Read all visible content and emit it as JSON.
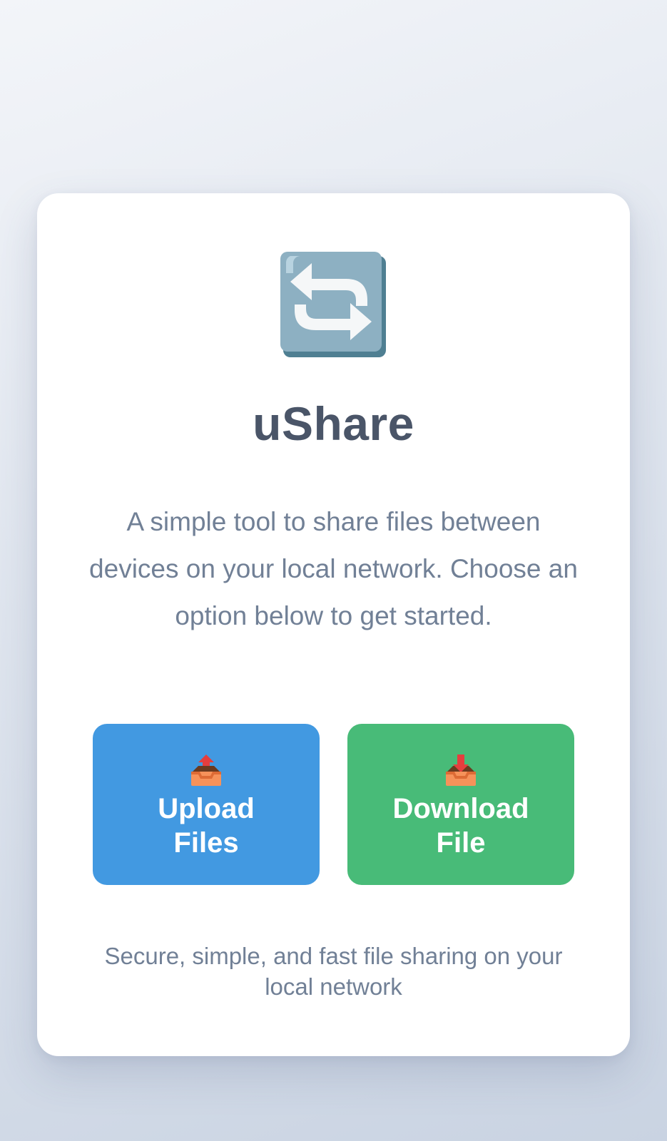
{
  "app": {
    "title": "uShare",
    "logo_icon": "repeat-arrows-icon",
    "description": "A simple tool to share files between devices on your local network. Choose an option below to get started."
  },
  "actions": {
    "upload": {
      "label": "Upload Files",
      "icon": "outbox-tray-icon",
      "color": "#4299e1"
    },
    "download": {
      "label": "Download File",
      "icon": "inbox-tray-icon",
      "color": "#48bb78"
    }
  },
  "footer": {
    "text": "Secure, simple, and fast file sharing on your local network"
  }
}
